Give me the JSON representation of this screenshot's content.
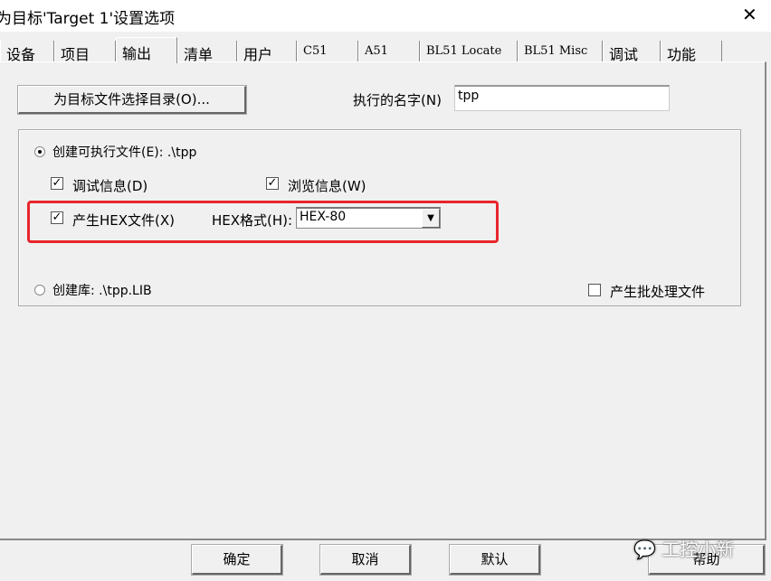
{
  "window": {
    "title": "为目标'Target 1'设置选项",
    "close_icon": "close-icon"
  },
  "tabs": [
    {
      "label": "设备",
      "mono": false
    },
    {
      "label": "项目",
      "mono": false
    },
    {
      "label": "输出",
      "mono": false,
      "selected": true
    },
    {
      "label": "清单",
      "mono": false
    },
    {
      "label": "用户",
      "mono": false
    },
    {
      "label": "C51",
      "mono": true
    },
    {
      "label": "A51",
      "mono": true
    },
    {
      "label": "BL51 Locate",
      "mono": true
    },
    {
      "label": "BL51 Misc",
      "mono": true
    },
    {
      "label": "调试",
      "mono": false
    },
    {
      "label": "功能",
      "mono": false
    }
  ],
  "output": {
    "select_dir_button": "为目标文件选择目录(O)...",
    "exec_name_label": "执行的名字(N)",
    "exec_name_value": "tpp",
    "create_exe_label": "创建可执行文件(E): .\\tpp",
    "create_exe_selected": true,
    "debug_info_label": "调试信息(D)",
    "debug_info_checked": true,
    "browse_info_label": "浏览信息(W)",
    "browse_info_checked": true,
    "create_hex_label": "产生HEX文件(X)",
    "create_hex_checked": true,
    "hex_format_label": "HEX格式(H):",
    "hex_format_value": "HEX-80",
    "create_lib_label": "创建库: .\\tpp.LIB",
    "create_lib_selected": false,
    "batch_file_label": "产生批处理文件",
    "batch_file_checked": false,
    "highlight_color": "#e8262b"
  },
  "footer": {
    "ok": "确定",
    "cancel": "取消",
    "defaults": "默认",
    "help": "帮助"
  },
  "watermark": "工控小新"
}
